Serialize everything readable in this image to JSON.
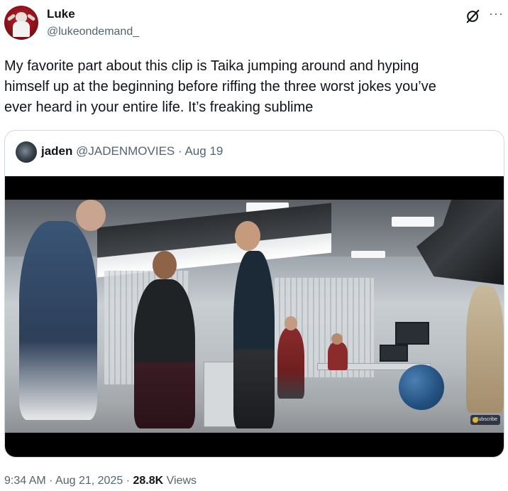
{
  "author": {
    "display_name": "Luke",
    "handle": "@lukeondemand_",
    "avatar_icon": "avatar-image"
  },
  "tweet": {
    "text": "My favorite part about this clip is Taika jumping around and hyping\nhimself up at the beginning before riffing the three worst jokes you’ve\never heard in your entire life. It’s freaking sublime"
  },
  "quoted": {
    "display_name": "jaden",
    "handle": "@JADENMOVIES",
    "separator": "·",
    "date": "Aug 19",
    "media_icon": "video-still",
    "badge_text": "Subscribe"
  },
  "meta": {
    "time": "9:34 AM",
    "sep1": "·",
    "date": "Aug 21, 2025",
    "sep2": "·",
    "views_count": "28.8K",
    "views_label": "Views"
  },
  "icons": {
    "grok": "grok-icon",
    "more": "more-options-icon"
  },
  "colors": {
    "text_primary": "#0f1419",
    "text_secondary": "#536471",
    "border": "#cfd9de"
  }
}
